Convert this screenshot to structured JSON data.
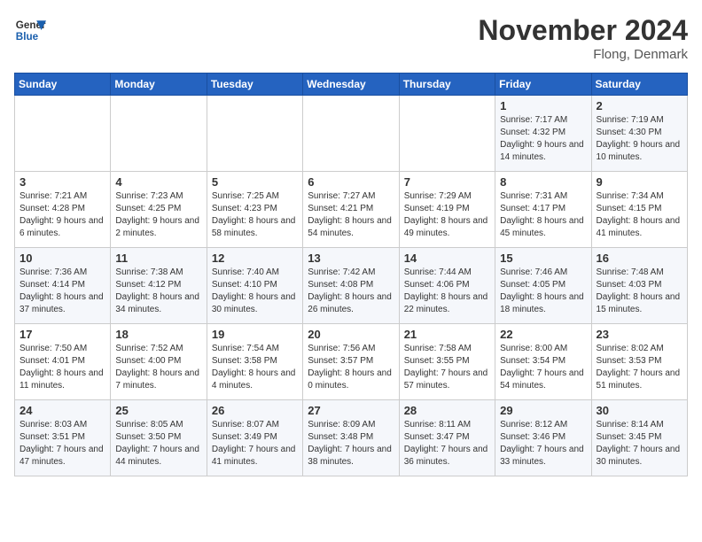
{
  "logo": {
    "line1": "General",
    "line2": "Blue"
  },
  "title": "November 2024",
  "subtitle": "Flong, Denmark",
  "header_days": [
    "Sunday",
    "Monday",
    "Tuesday",
    "Wednesday",
    "Thursday",
    "Friday",
    "Saturday"
  ],
  "weeks": [
    [
      {
        "day": "",
        "info": ""
      },
      {
        "day": "",
        "info": ""
      },
      {
        "day": "",
        "info": ""
      },
      {
        "day": "",
        "info": ""
      },
      {
        "day": "",
        "info": ""
      },
      {
        "day": "1",
        "info": "Sunrise: 7:17 AM\nSunset: 4:32 PM\nDaylight: 9 hours and 14 minutes."
      },
      {
        "day": "2",
        "info": "Sunrise: 7:19 AM\nSunset: 4:30 PM\nDaylight: 9 hours and 10 minutes."
      }
    ],
    [
      {
        "day": "3",
        "info": "Sunrise: 7:21 AM\nSunset: 4:28 PM\nDaylight: 9 hours and 6 minutes."
      },
      {
        "day": "4",
        "info": "Sunrise: 7:23 AM\nSunset: 4:25 PM\nDaylight: 9 hours and 2 minutes."
      },
      {
        "day": "5",
        "info": "Sunrise: 7:25 AM\nSunset: 4:23 PM\nDaylight: 8 hours and 58 minutes."
      },
      {
        "day": "6",
        "info": "Sunrise: 7:27 AM\nSunset: 4:21 PM\nDaylight: 8 hours and 54 minutes."
      },
      {
        "day": "7",
        "info": "Sunrise: 7:29 AM\nSunset: 4:19 PM\nDaylight: 8 hours and 49 minutes."
      },
      {
        "day": "8",
        "info": "Sunrise: 7:31 AM\nSunset: 4:17 PM\nDaylight: 8 hours and 45 minutes."
      },
      {
        "day": "9",
        "info": "Sunrise: 7:34 AM\nSunset: 4:15 PM\nDaylight: 8 hours and 41 minutes."
      }
    ],
    [
      {
        "day": "10",
        "info": "Sunrise: 7:36 AM\nSunset: 4:14 PM\nDaylight: 8 hours and 37 minutes."
      },
      {
        "day": "11",
        "info": "Sunrise: 7:38 AM\nSunset: 4:12 PM\nDaylight: 8 hours and 34 minutes."
      },
      {
        "day": "12",
        "info": "Sunrise: 7:40 AM\nSunset: 4:10 PM\nDaylight: 8 hours and 30 minutes."
      },
      {
        "day": "13",
        "info": "Sunrise: 7:42 AM\nSunset: 4:08 PM\nDaylight: 8 hours and 26 minutes."
      },
      {
        "day": "14",
        "info": "Sunrise: 7:44 AM\nSunset: 4:06 PM\nDaylight: 8 hours and 22 minutes."
      },
      {
        "day": "15",
        "info": "Sunrise: 7:46 AM\nSunset: 4:05 PM\nDaylight: 8 hours and 18 minutes."
      },
      {
        "day": "16",
        "info": "Sunrise: 7:48 AM\nSunset: 4:03 PM\nDaylight: 8 hours and 15 minutes."
      }
    ],
    [
      {
        "day": "17",
        "info": "Sunrise: 7:50 AM\nSunset: 4:01 PM\nDaylight: 8 hours and 11 minutes."
      },
      {
        "day": "18",
        "info": "Sunrise: 7:52 AM\nSunset: 4:00 PM\nDaylight: 8 hours and 7 minutes."
      },
      {
        "day": "19",
        "info": "Sunrise: 7:54 AM\nSunset: 3:58 PM\nDaylight: 8 hours and 4 minutes."
      },
      {
        "day": "20",
        "info": "Sunrise: 7:56 AM\nSunset: 3:57 PM\nDaylight: 8 hours and 0 minutes."
      },
      {
        "day": "21",
        "info": "Sunrise: 7:58 AM\nSunset: 3:55 PM\nDaylight: 7 hours and 57 minutes."
      },
      {
        "day": "22",
        "info": "Sunrise: 8:00 AM\nSunset: 3:54 PM\nDaylight: 7 hours and 54 minutes."
      },
      {
        "day": "23",
        "info": "Sunrise: 8:02 AM\nSunset: 3:53 PM\nDaylight: 7 hours and 51 minutes."
      }
    ],
    [
      {
        "day": "24",
        "info": "Sunrise: 8:03 AM\nSunset: 3:51 PM\nDaylight: 7 hours and 47 minutes."
      },
      {
        "day": "25",
        "info": "Sunrise: 8:05 AM\nSunset: 3:50 PM\nDaylight: 7 hours and 44 minutes."
      },
      {
        "day": "26",
        "info": "Sunrise: 8:07 AM\nSunset: 3:49 PM\nDaylight: 7 hours and 41 minutes."
      },
      {
        "day": "27",
        "info": "Sunrise: 8:09 AM\nSunset: 3:48 PM\nDaylight: 7 hours and 38 minutes."
      },
      {
        "day": "28",
        "info": "Sunrise: 8:11 AM\nSunset: 3:47 PM\nDaylight: 7 hours and 36 minutes."
      },
      {
        "day": "29",
        "info": "Sunrise: 8:12 AM\nSunset: 3:46 PM\nDaylight: 7 hours and 33 minutes."
      },
      {
        "day": "30",
        "info": "Sunrise: 8:14 AM\nSunset: 3:45 PM\nDaylight: 7 hours and 30 minutes."
      }
    ]
  ]
}
